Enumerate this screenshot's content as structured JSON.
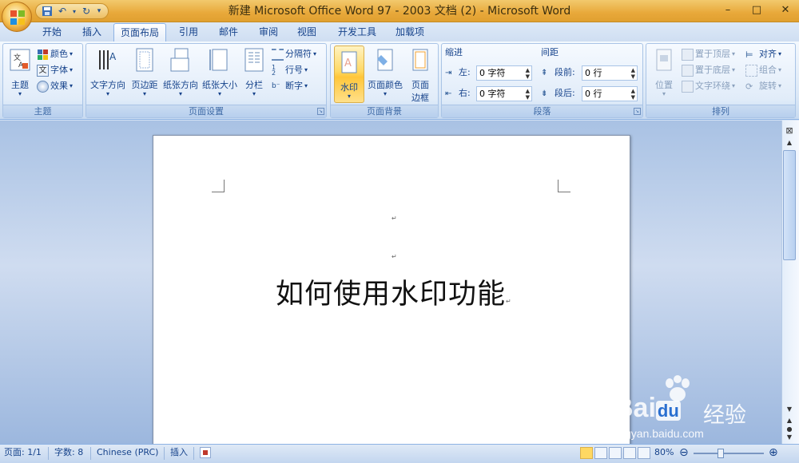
{
  "window": {
    "title": "新建 Microsoft Office Word 97 - 2003 文档 (2) - Microsoft Word",
    "controls": {
      "minimize": "–",
      "maximize": "□",
      "close": "✕"
    }
  },
  "qat": {
    "save": "save-icon",
    "undo": "undo-icon",
    "redo": "redo-icon",
    "more": "▾"
  },
  "tabs": [
    "开始",
    "插入",
    "页面布局",
    "引用",
    "邮件",
    "审阅",
    "视图",
    "开发工具",
    "加载项"
  ],
  "active_tab": "页面布局",
  "ribbon": {
    "theme": {
      "label": "主题",
      "themes": "主题",
      "colors": "颜色",
      "fonts": "字体",
      "effects": "效果"
    },
    "page_setup": {
      "label": "页面设置",
      "text_direction": "文字方向",
      "margins": "页边距",
      "orientation": "纸张方向",
      "size": "纸张大小",
      "columns": "分栏",
      "breaks": "分隔符",
      "line_numbers": "行号",
      "hyphenation": "断字"
    },
    "page_background": {
      "label": "页面背景",
      "watermark": "水印",
      "page_color": "页面颜色",
      "page_borders_1": "页面",
      "page_borders_2": "边框"
    },
    "paragraph": {
      "label": "段落",
      "indent": "缩进",
      "spacing": "间距",
      "left": "左:",
      "right": "右:",
      "left_value": "0 字符",
      "right_value": "0 字符",
      "before": "段前:",
      "after": "段后:",
      "before_value": "0 行",
      "after_value": "0 行"
    },
    "arrange": {
      "label": "排列",
      "position": "位置",
      "bring_front": "置于顶层",
      "send_back": "置于底层",
      "text_wrap": "文字环绕",
      "align": "对齐",
      "group": "组合",
      "rotate": "旋转"
    }
  },
  "document": {
    "text": "如何使用水印功能",
    "para_mark": "↵"
  },
  "status": {
    "page": "页面: 1/1",
    "words": "字数: 8",
    "language": "Chinese (PRC)",
    "mode": "插入",
    "zoom": "80%",
    "zoom_out": "⊖",
    "zoom_in": "⊕"
  },
  "watermark": {
    "brand": "Bai",
    "brand2": "du",
    "cn": "经验",
    "url": "jingyan.baidu.com"
  },
  "colors": {
    "accent": "#15428b",
    "title_bar": "#e8a83a",
    "highlight": "#ffd862"
  }
}
